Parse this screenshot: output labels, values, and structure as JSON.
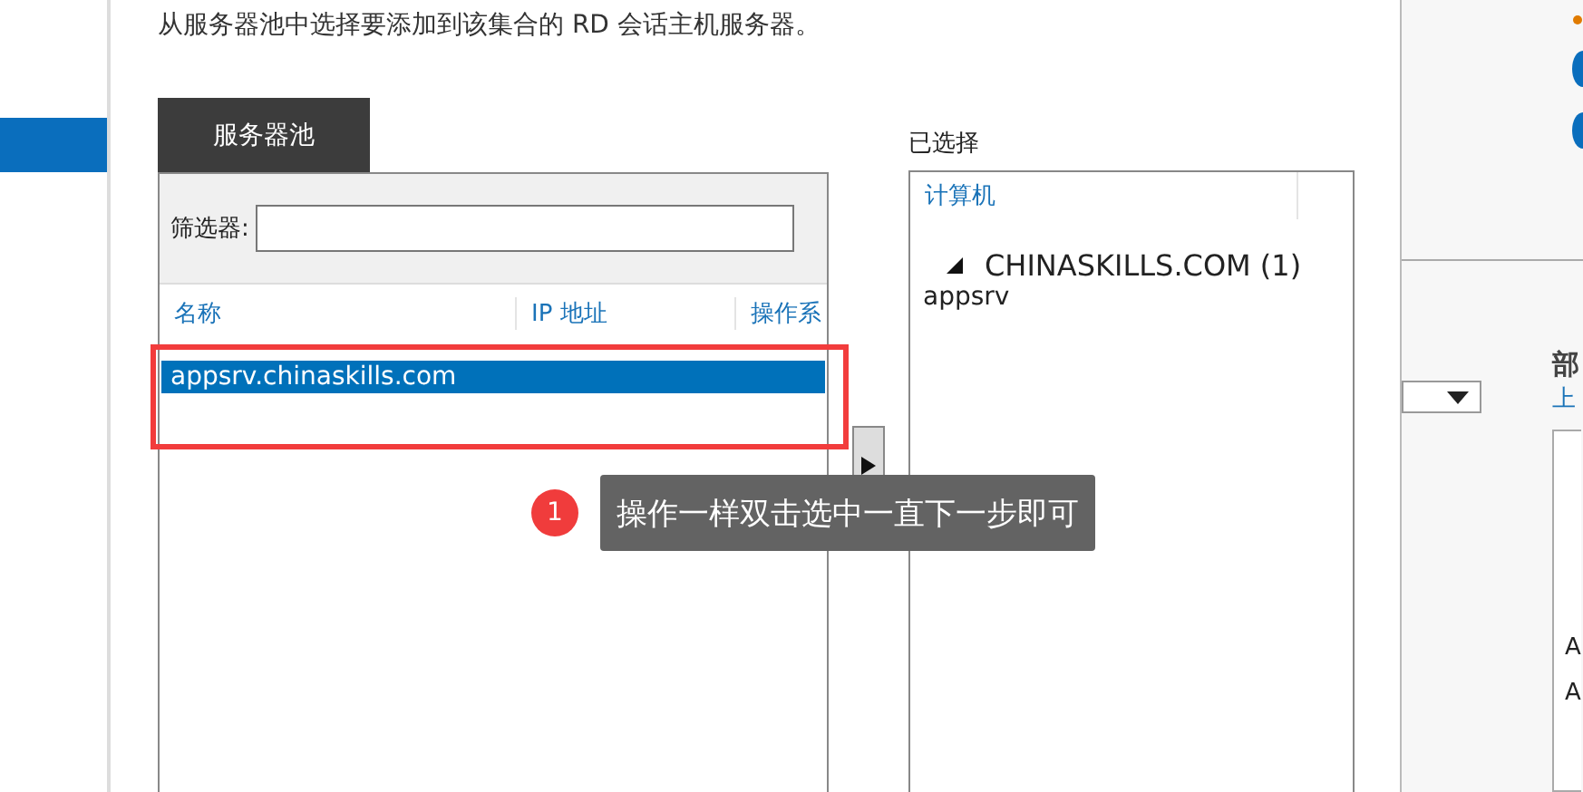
{
  "sidebar": {
    "items": [
      {
        "selected": true
      }
    ]
  },
  "instruction": "从服务器池中选择要添加到该集合的 RD 会话主机服务器。",
  "server_pool": {
    "tab": "服务器池",
    "filter_label": "筛选器:",
    "columns": [
      "名称",
      "IP 地址",
      "操作系"
    ],
    "rows": [
      {
        "name": "appsrv.chinaskills.com",
        "selected": true
      }
    ]
  },
  "selected": {
    "label": "已选择",
    "column": "计算机",
    "groups": [
      {
        "name": "CHINASKILLS.COM (1)",
        "expanded": true,
        "children": [
          "appsrv"
        ]
      }
    ]
  },
  "annotation": {
    "number": "1",
    "text": "操作一样双击选中一直下一步即可"
  },
  "background_panel": {
    "heading": "部",
    "subheading": "上",
    "list_items": [
      "A",
      "A"
    ]
  }
}
